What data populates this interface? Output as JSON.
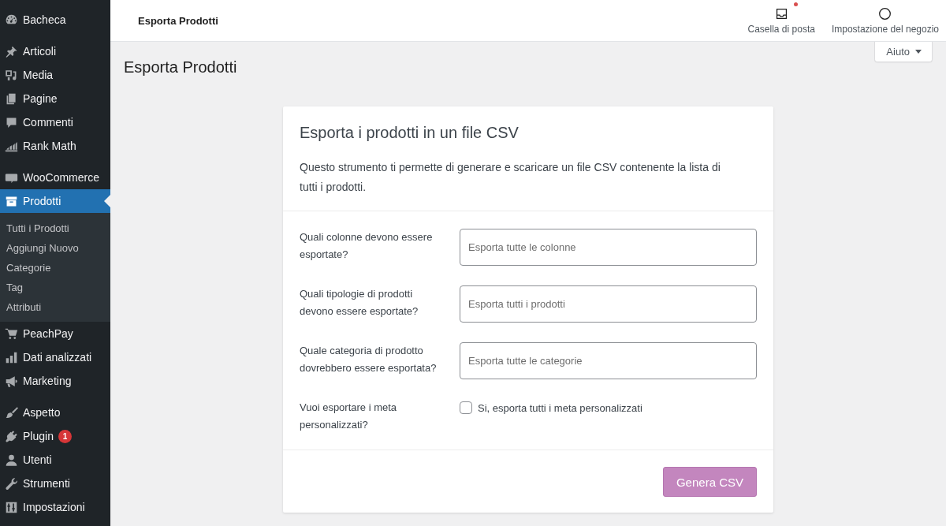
{
  "sidebar": {
    "groups": [
      [
        {
          "label": "Bacheca",
          "selected": false
        }
      ],
      [
        {
          "label": "Articoli",
          "selected": false
        },
        {
          "label": "Media",
          "selected": false
        },
        {
          "label": "Pagine",
          "selected": false
        },
        {
          "label": "Commenti",
          "selected": false
        },
        {
          "label": "Rank Math",
          "selected": false
        }
      ],
      [
        {
          "label": "WooCommerce",
          "selected": false
        },
        {
          "label": "Prodotti",
          "selected": true,
          "children": [
            {
              "label": "Tutti i Prodotti",
              "selected": false
            },
            {
              "label": "Aggiungi Nuovo",
              "selected": false
            },
            {
              "label": "Categorie",
              "selected": false
            },
            {
              "label": "Tag",
              "selected": false
            },
            {
              "label": "Attributi",
              "selected": false
            }
          ]
        },
        {
          "label": "PeachPay",
          "selected": false
        },
        {
          "label": "Dati analizzati",
          "selected": false
        },
        {
          "label": "Marketing",
          "selected": false
        }
      ],
      [
        {
          "label": "Aspetto",
          "selected": false
        },
        {
          "label": "Plugin",
          "selected": false,
          "badge": "1"
        },
        {
          "label": "Utenti",
          "selected": false
        },
        {
          "label": "Strumenti",
          "selected": false
        },
        {
          "label": "Impostazioni",
          "selected": false
        }
      ]
    ]
  },
  "top_bar": {
    "title": "Esporta Prodotti",
    "actions": [
      {
        "label": "Casella di posta",
        "unread": true
      },
      {
        "label": "Impostazione del negozio",
        "unread": false
      }
    ]
  },
  "page": {
    "title": "Esporta Prodotti",
    "help_button": "Aiuto"
  },
  "card": {
    "title": "Esporta i prodotti in un file CSV",
    "description": "Questo strumento ti permette di generare e scaricare un file CSV contenente la lista di tutti i prodotti.",
    "fields": [
      {
        "kind": "select",
        "label": "Quali colonne devono essere esportate?",
        "placeholder": "Esporta tutte le colonne"
      },
      {
        "kind": "select",
        "label": "Quali tipologie di prodotti devono essere esportate?",
        "placeholder": "Esporta tutti i prodotti"
      },
      {
        "kind": "select",
        "label": "Quale categoria di prodotto dovrebbero essere esportata?",
        "placeholder": "Esporta tutte le categorie"
      },
      {
        "kind": "checkbox",
        "label": "Vuoi esportare i meta personalizzati?",
        "option": "Si, esporta tutti i meta personalizzati",
        "checked": false
      }
    ],
    "submit_button": "Genera CSV"
  }
}
